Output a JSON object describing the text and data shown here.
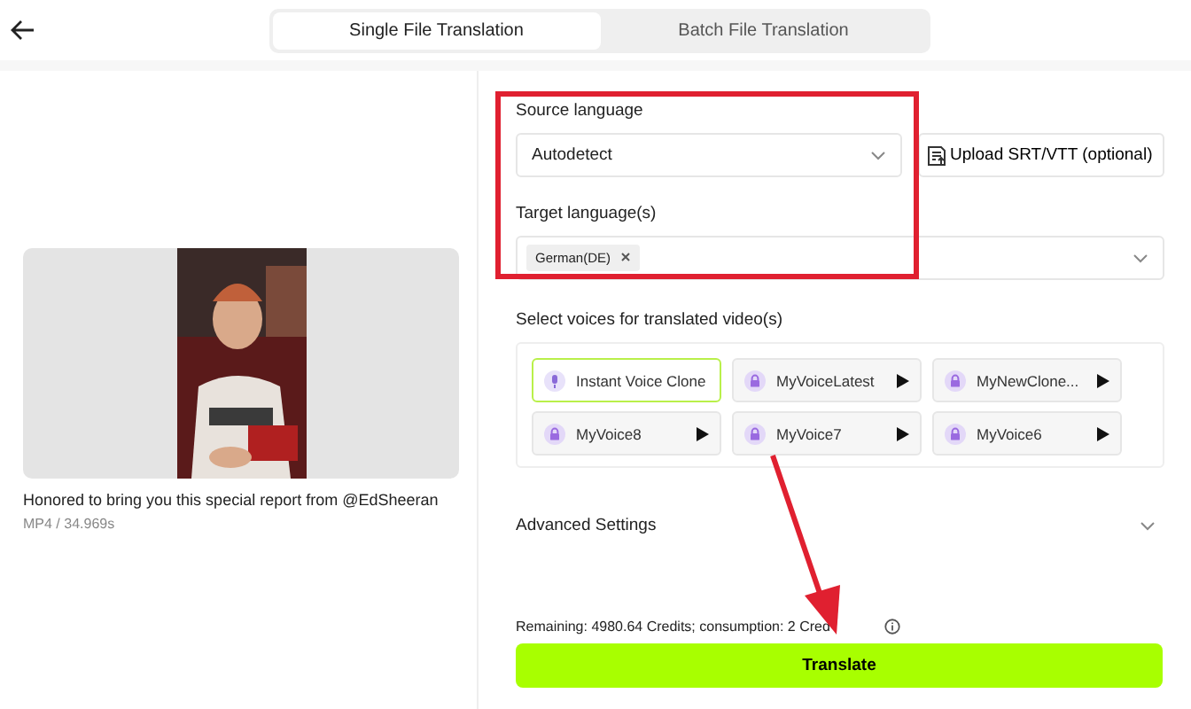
{
  "tabs": [
    {
      "label": "Single File Translation",
      "selected": true
    },
    {
      "label": "Batch File Translation",
      "selected": false
    }
  ],
  "video": {
    "caption": "Honored to bring you this special report from @EdSheeran",
    "meta": "MP4 / 34.969s"
  },
  "source_language": {
    "label": "Source language",
    "value": "Autodetect"
  },
  "upload_button": "Upload SRT/VTT (optional)",
  "target_languages": {
    "label": "Target language(s)",
    "tags": [
      "German(DE)"
    ]
  },
  "voices": {
    "label": "Select voices for translated video(s)",
    "items": [
      {
        "name": "Instant Voice Clone",
        "kind": "clone",
        "selected": true
      },
      {
        "name": "MyVoiceLatest",
        "kind": "voice",
        "selected": false
      },
      {
        "name": "MyNewClone...",
        "kind": "voice",
        "selected": false
      },
      {
        "name": "MyVoice8",
        "kind": "voice",
        "selected": false
      },
      {
        "name": "MyVoice7",
        "kind": "voice",
        "selected": false
      },
      {
        "name": "MyVoice6",
        "kind": "voice",
        "selected": false
      }
    ]
  },
  "advanced_settings": {
    "label": "Advanced Settings",
    "expanded": false
  },
  "credits": "Remaining: 4980.64 Credits; consumption: 2 Cred",
  "translate_button": "Translate"
}
